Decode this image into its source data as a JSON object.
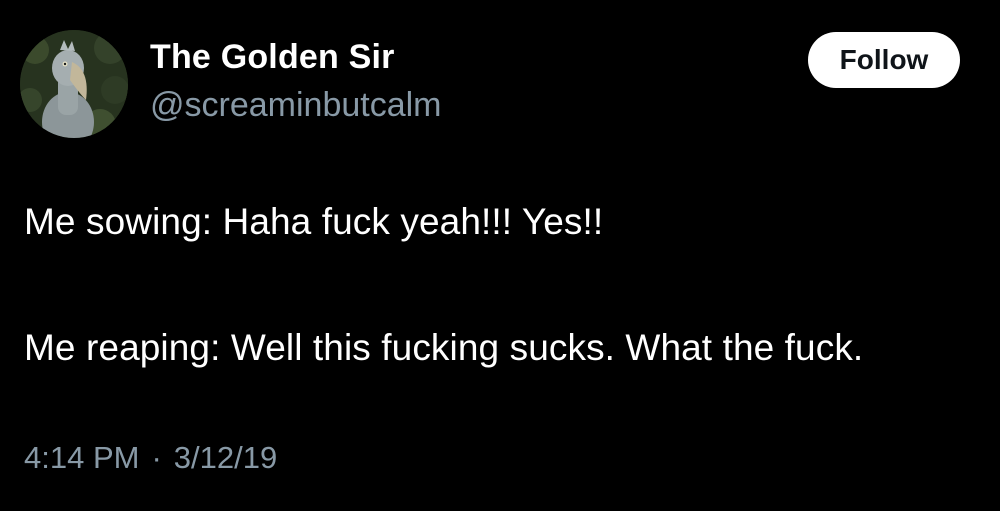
{
  "user": {
    "display_name": "The Golden Sir",
    "handle": "@screaminbutcalm",
    "avatar_icon": "shoebill-bird-avatar"
  },
  "follow_button": {
    "label": "Follow"
  },
  "tweet": {
    "lines": [
      "Me sowing: Haha fuck yeah!!! Yes!!",
      "Me reaping: Well this fucking sucks. What the fuck."
    ],
    "time": "4:14 PM",
    "separator": "·",
    "date": "3/12/19"
  },
  "colors": {
    "background": "#000000",
    "primary_text": "#ffffff",
    "secondary_text": "#8899a6",
    "button_bg": "#ffffff",
    "button_text": "#0f1419"
  }
}
